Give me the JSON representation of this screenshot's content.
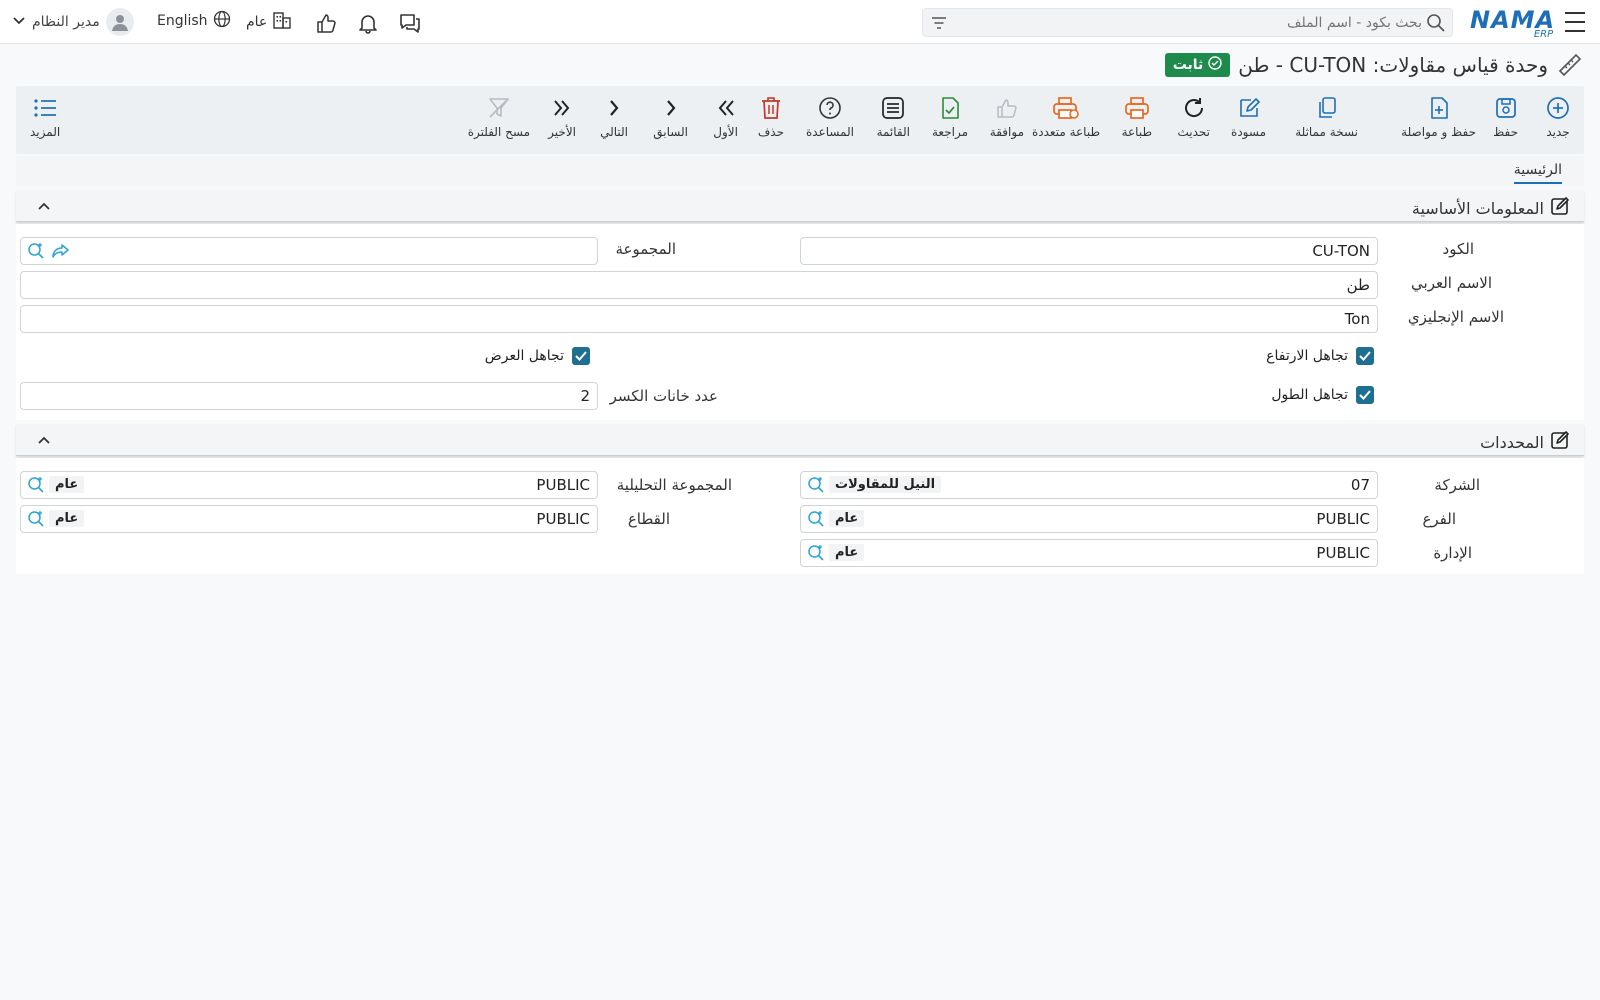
{
  "topbar": {
    "logo_text": "NAMA",
    "logo_sub": "ERP",
    "search_placeholder": "بحث بكود - اسم الملف",
    "user_name": "مدير النظام",
    "language": "English",
    "company": "عام"
  },
  "page": {
    "title": "وحدة قياس مقاولات: CU-TON - طن",
    "status_badge": "ثابت"
  },
  "toolbar": {
    "new": "جديد",
    "save": "حفظ",
    "save_continue": "حفظ و مواصلة",
    "duplicate": "نسخة مماثلة",
    "draft": "مسودة",
    "refresh": "تحديث",
    "print": "طباعة",
    "multi_print": "طباعة متعددة",
    "approve": "موافقة",
    "review": "مراجعة",
    "list": "القائمة",
    "help": "المساعدة",
    "delete": "حذف",
    "first": "الأول",
    "previous": "السابق",
    "next": "التالي",
    "last": "الأخير",
    "clear_filter": "مسح الفلترة",
    "more": "المزيد"
  },
  "tabs": {
    "main": "الرئيسية"
  },
  "basic_info": {
    "title": "المعلومات الأساسية",
    "code_label": "الكود",
    "code_value": "CU-TON",
    "group_label": "المجموعة",
    "group_value": "",
    "arabic_name_label": "الاسم العربي",
    "arabic_name_value": "طن",
    "english_name_label": "الاسم الإنجليزي",
    "english_name_value": "Ton",
    "ignore_height_label": "تجاهل الارتفاع",
    "ignore_height_checked": true,
    "ignore_width_label": "تجاهل العرض",
    "ignore_width_checked": true,
    "ignore_length_label": "تجاهل الطول",
    "ignore_length_checked": true,
    "decimal_places_label": "عدد خانات الكسر",
    "decimal_places_value": "2"
  },
  "dimensions": {
    "title": "المحددات",
    "company_label": "الشركة",
    "company_code": "07",
    "company_name": "النيل للمقاولات",
    "analytic_group_label": "المجموعة التحليلية",
    "analytic_group_code": "PUBLIC",
    "analytic_group_name": "عام",
    "branch_label": "الفرع",
    "branch_code": "PUBLIC",
    "branch_name": "عام",
    "sector_label": "القطاع",
    "sector_code": "PUBLIC",
    "sector_name": "عام",
    "department_label": "الإدارة",
    "department_code": "PUBLIC",
    "department_name": "عام"
  },
  "colors": {
    "brand": "#1e6fb7",
    "badge": "#1e8a4c",
    "orange_icon": "#e8681e",
    "green_icon": "#2e8b3a",
    "red_icon": "#c0392b",
    "checkbox": "#1f6f93"
  }
}
